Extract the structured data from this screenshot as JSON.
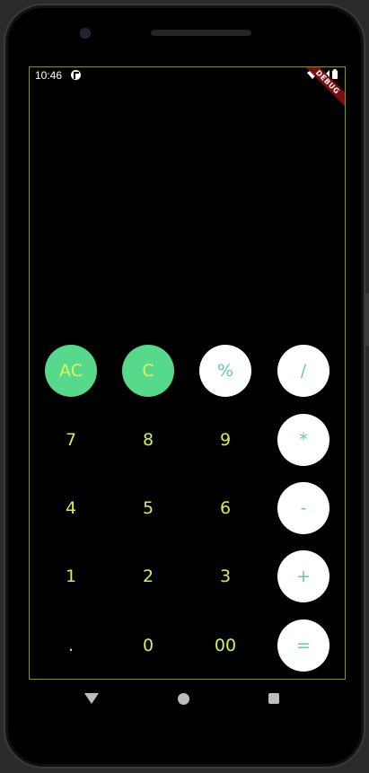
{
  "status_bar": {
    "time": "10:46",
    "debug_banner": "DEBUG"
  },
  "keypad": {
    "rows": [
      [
        {
          "label": "AC",
          "style": "green",
          "name": "all-clear-button"
        },
        {
          "label": "C",
          "style": "green",
          "name": "clear-button"
        },
        {
          "label": "%",
          "style": "white",
          "name": "percent-button"
        },
        {
          "label": "/",
          "style": "white",
          "name": "divide-button"
        }
      ],
      [
        {
          "label": "7",
          "style": "plain",
          "name": "digit-7-button"
        },
        {
          "label": "8",
          "style": "plain",
          "name": "digit-8-button"
        },
        {
          "label": "9",
          "style": "plain",
          "name": "digit-9-button"
        },
        {
          "label": "*",
          "style": "white",
          "name": "multiply-button"
        }
      ],
      [
        {
          "label": "4",
          "style": "plain",
          "name": "digit-4-button"
        },
        {
          "label": "5",
          "style": "plain",
          "name": "digit-5-button"
        },
        {
          "label": "6",
          "style": "plain",
          "name": "digit-6-button"
        },
        {
          "label": "-",
          "style": "white",
          "name": "subtract-button"
        }
      ],
      [
        {
          "label": "1",
          "style": "plain",
          "name": "digit-1-button"
        },
        {
          "label": "2",
          "style": "plain",
          "name": "digit-2-button"
        },
        {
          "label": "3",
          "style": "plain",
          "name": "digit-3-button"
        },
        {
          "label": "+",
          "style": "white",
          "name": "add-button"
        }
      ],
      [
        {
          "label": ".",
          "style": "plain",
          "name": "decimal-button"
        },
        {
          "label": "0",
          "style": "plain",
          "name": "digit-0-button"
        },
        {
          "label": "00",
          "style": "plain",
          "name": "double-zero-button"
        },
        {
          "label": "=",
          "style": "white",
          "name": "equals-button"
        }
      ]
    ]
  },
  "colors": {
    "green_key": "#56d98b",
    "white_key": "#ffffff",
    "digit_text": "#d6ec5a",
    "operator_text": "#5fc9b2",
    "screen_outline": "#7a9a10"
  },
  "nav_bar": {
    "icons": [
      "back-icon",
      "home-icon",
      "recents-icon"
    ]
  }
}
